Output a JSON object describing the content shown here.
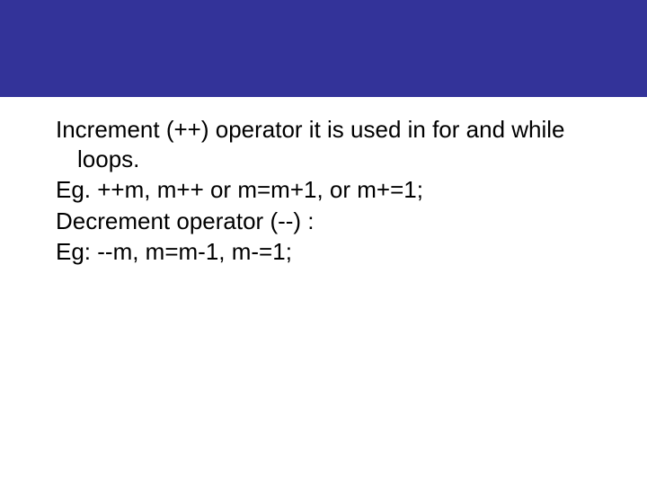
{
  "slide": {
    "line1": "Increment (++) operator it is used in for and while loops.",
    "line2": "Eg. ++m, m++ or m=m+1, or m+=1;",
    "line3": "Decrement operator (--) :",
    "line4": "Eg:  --m, m=m-1, m-=1;"
  },
  "colors": {
    "headerBackground": "#333399",
    "text": "#000000",
    "slideBackground": "#ffffff"
  }
}
